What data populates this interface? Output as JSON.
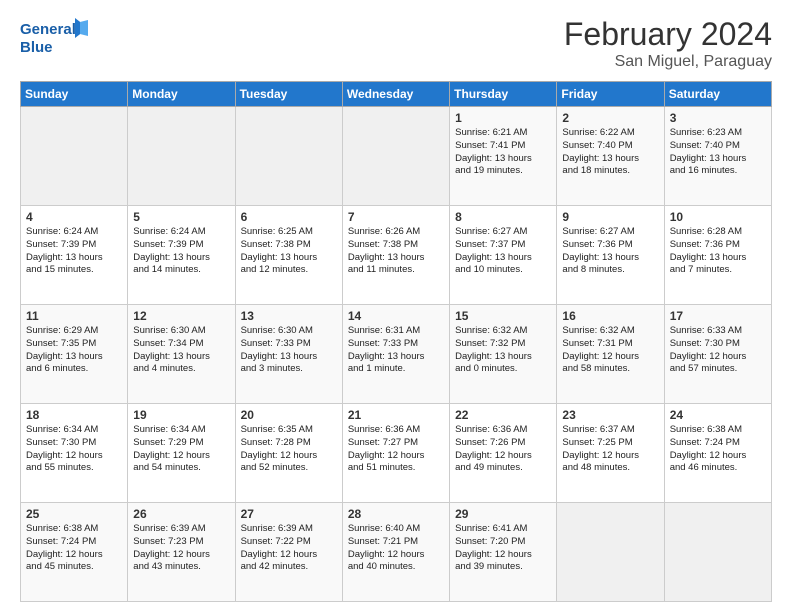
{
  "header": {
    "logo_line1": "General",
    "logo_line2": "Blue",
    "month_year": "February 2024",
    "location": "San Miguel, Paraguay"
  },
  "days_of_week": [
    "Sunday",
    "Monday",
    "Tuesday",
    "Wednesday",
    "Thursday",
    "Friday",
    "Saturday"
  ],
  "weeks": [
    [
      {
        "day": "",
        "info": ""
      },
      {
        "day": "",
        "info": ""
      },
      {
        "day": "",
        "info": ""
      },
      {
        "day": "",
        "info": ""
      },
      {
        "day": "1",
        "info": "Sunrise: 6:21 AM\nSunset: 7:41 PM\nDaylight: 13 hours\nand 19 minutes."
      },
      {
        "day": "2",
        "info": "Sunrise: 6:22 AM\nSunset: 7:40 PM\nDaylight: 13 hours\nand 18 minutes."
      },
      {
        "day": "3",
        "info": "Sunrise: 6:23 AM\nSunset: 7:40 PM\nDaylight: 13 hours\nand 16 minutes."
      }
    ],
    [
      {
        "day": "4",
        "info": "Sunrise: 6:24 AM\nSunset: 7:39 PM\nDaylight: 13 hours\nand 15 minutes."
      },
      {
        "day": "5",
        "info": "Sunrise: 6:24 AM\nSunset: 7:39 PM\nDaylight: 13 hours\nand 14 minutes."
      },
      {
        "day": "6",
        "info": "Sunrise: 6:25 AM\nSunset: 7:38 PM\nDaylight: 13 hours\nand 12 minutes."
      },
      {
        "day": "7",
        "info": "Sunrise: 6:26 AM\nSunset: 7:38 PM\nDaylight: 13 hours\nand 11 minutes."
      },
      {
        "day": "8",
        "info": "Sunrise: 6:27 AM\nSunset: 7:37 PM\nDaylight: 13 hours\nand 10 minutes."
      },
      {
        "day": "9",
        "info": "Sunrise: 6:27 AM\nSunset: 7:36 PM\nDaylight: 13 hours\nand 8 minutes."
      },
      {
        "day": "10",
        "info": "Sunrise: 6:28 AM\nSunset: 7:36 PM\nDaylight: 13 hours\nand 7 minutes."
      }
    ],
    [
      {
        "day": "11",
        "info": "Sunrise: 6:29 AM\nSunset: 7:35 PM\nDaylight: 13 hours\nand 6 minutes."
      },
      {
        "day": "12",
        "info": "Sunrise: 6:30 AM\nSunset: 7:34 PM\nDaylight: 13 hours\nand 4 minutes."
      },
      {
        "day": "13",
        "info": "Sunrise: 6:30 AM\nSunset: 7:33 PM\nDaylight: 13 hours\nand 3 minutes."
      },
      {
        "day": "14",
        "info": "Sunrise: 6:31 AM\nSunset: 7:33 PM\nDaylight: 13 hours\nand 1 minute."
      },
      {
        "day": "15",
        "info": "Sunrise: 6:32 AM\nSunset: 7:32 PM\nDaylight: 13 hours\nand 0 minutes."
      },
      {
        "day": "16",
        "info": "Sunrise: 6:32 AM\nSunset: 7:31 PM\nDaylight: 12 hours\nand 58 minutes."
      },
      {
        "day": "17",
        "info": "Sunrise: 6:33 AM\nSunset: 7:30 PM\nDaylight: 12 hours\nand 57 minutes."
      }
    ],
    [
      {
        "day": "18",
        "info": "Sunrise: 6:34 AM\nSunset: 7:30 PM\nDaylight: 12 hours\nand 55 minutes."
      },
      {
        "day": "19",
        "info": "Sunrise: 6:34 AM\nSunset: 7:29 PM\nDaylight: 12 hours\nand 54 minutes."
      },
      {
        "day": "20",
        "info": "Sunrise: 6:35 AM\nSunset: 7:28 PM\nDaylight: 12 hours\nand 52 minutes."
      },
      {
        "day": "21",
        "info": "Sunrise: 6:36 AM\nSunset: 7:27 PM\nDaylight: 12 hours\nand 51 minutes."
      },
      {
        "day": "22",
        "info": "Sunrise: 6:36 AM\nSunset: 7:26 PM\nDaylight: 12 hours\nand 49 minutes."
      },
      {
        "day": "23",
        "info": "Sunrise: 6:37 AM\nSunset: 7:25 PM\nDaylight: 12 hours\nand 48 minutes."
      },
      {
        "day": "24",
        "info": "Sunrise: 6:38 AM\nSunset: 7:24 PM\nDaylight: 12 hours\nand 46 minutes."
      }
    ],
    [
      {
        "day": "25",
        "info": "Sunrise: 6:38 AM\nSunset: 7:24 PM\nDaylight: 12 hours\nand 45 minutes."
      },
      {
        "day": "26",
        "info": "Sunrise: 6:39 AM\nSunset: 7:23 PM\nDaylight: 12 hours\nand 43 minutes."
      },
      {
        "day": "27",
        "info": "Sunrise: 6:39 AM\nSunset: 7:22 PM\nDaylight: 12 hours\nand 42 minutes."
      },
      {
        "day": "28",
        "info": "Sunrise: 6:40 AM\nSunset: 7:21 PM\nDaylight: 12 hours\nand 40 minutes."
      },
      {
        "day": "29",
        "info": "Sunrise: 6:41 AM\nSunset: 7:20 PM\nDaylight: 12 hours\nand 39 minutes."
      },
      {
        "day": "",
        "info": ""
      },
      {
        "day": "",
        "info": ""
      }
    ]
  ]
}
